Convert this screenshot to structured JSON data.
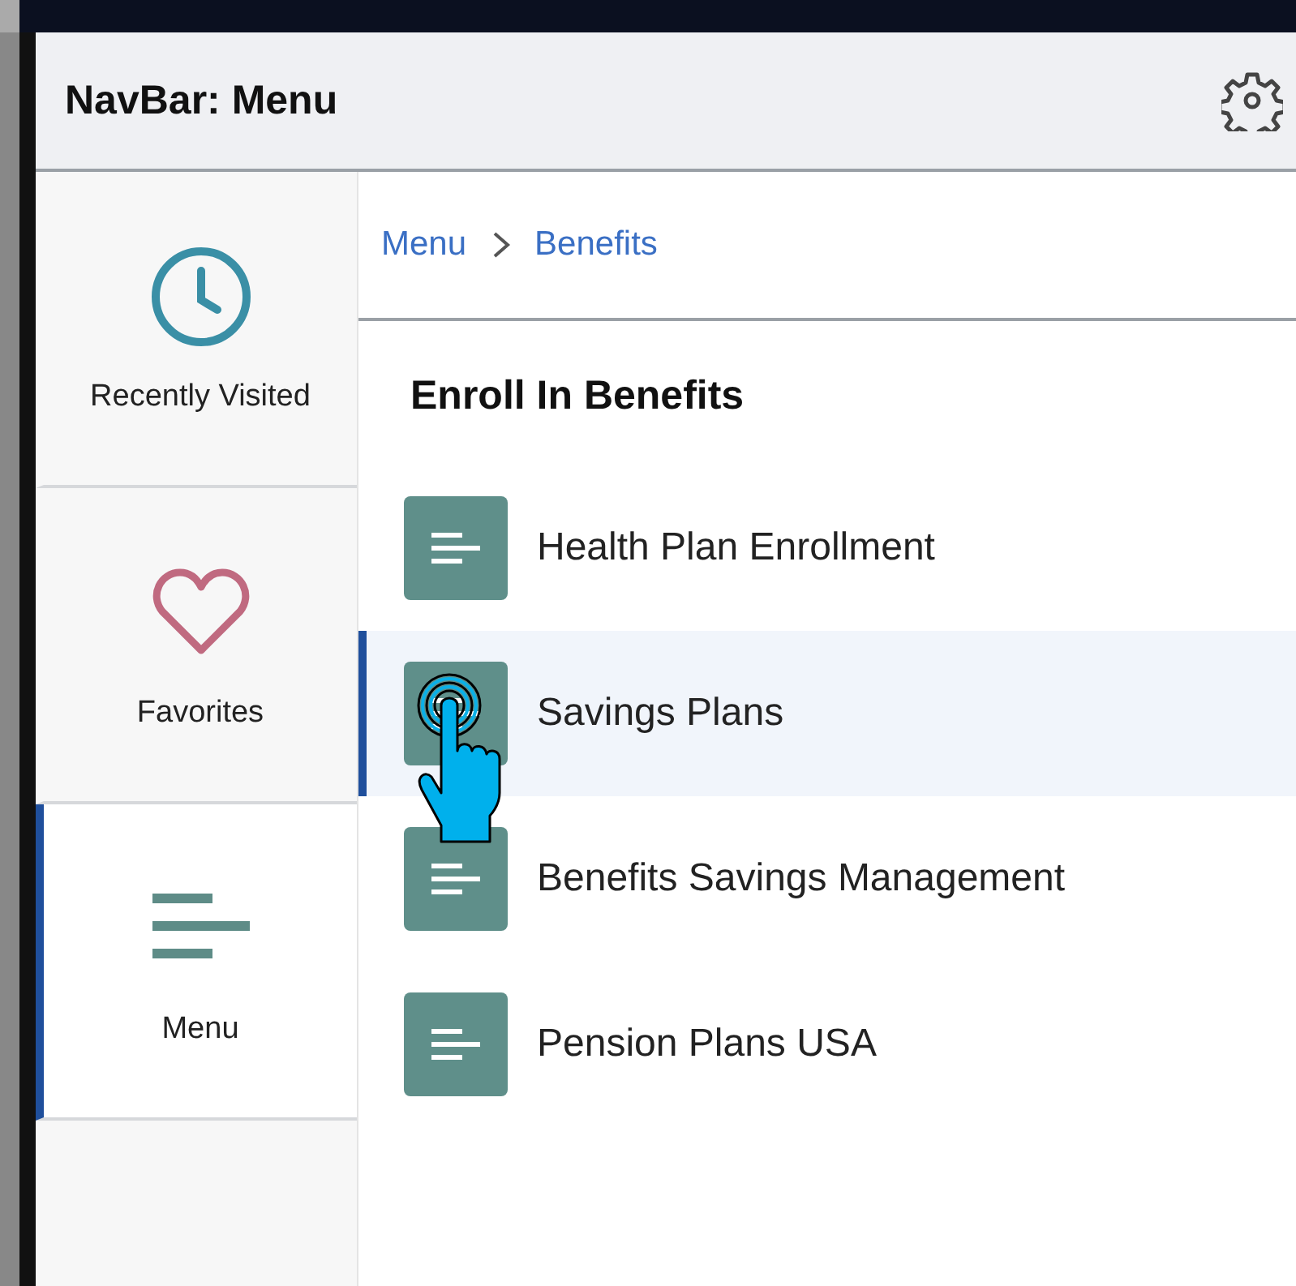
{
  "header": {
    "title": "NavBar: Menu"
  },
  "sidebar": {
    "items": [
      {
        "kind": "clock",
        "label": "Recently Visited",
        "selected": false
      },
      {
        "kind": "heart",
        "label": "Favorites",
        "selected": false
      },
      {
        "kind": "menu",
        "label": "Menu",
        "selected": true
      }
    ]
  },
  "breadcrumb": [
    {
      "label": "Menu"
    },
    {
      "label": "Benefits"
    }
  ],
  "section": {
    "title": "Enroll In Benefits",
    "items": [
      {
        "label": "Health Plan Enrollment",
        "selected": false
      },
      {
        "label": "Savings Plans",
        "selected": true
      },
      {
        "label": "Benefits Savings Management",
        "selected": false
      },
      {
        "label": "Pension Plans USA",
        "selected": false
      }
    ]
  }
}
